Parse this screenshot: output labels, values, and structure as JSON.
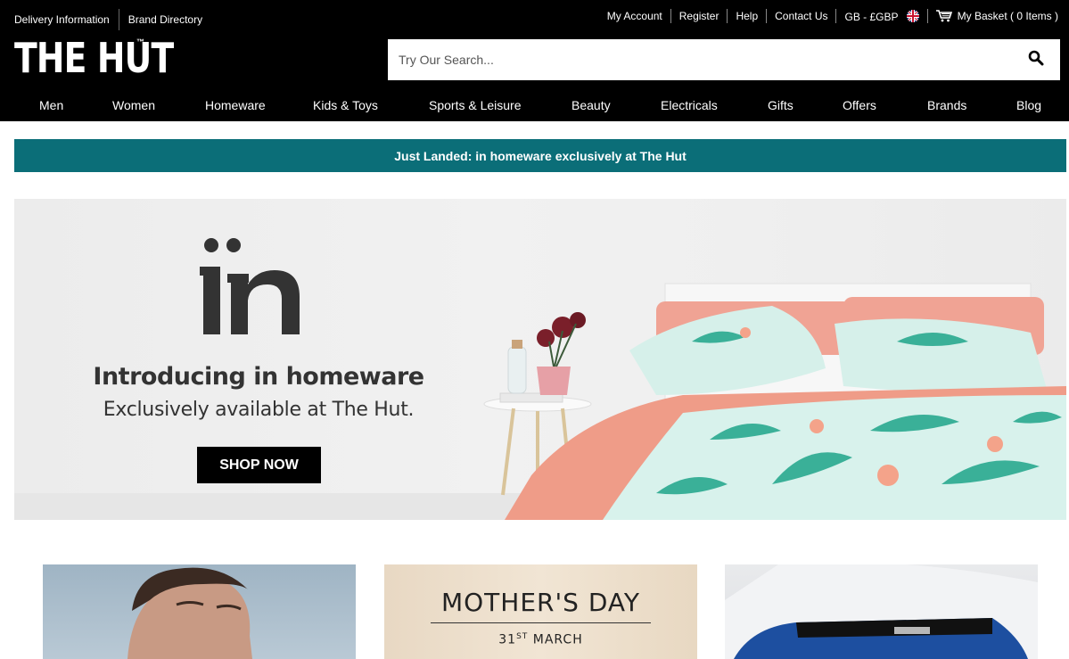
{
  "header": {
    "util_left": [
      "Delivery Information",
      "Brand Directory"
    ],
    "util_right": {
      "my_account": "My Account",
      "register": "Register",
      "help": "Help",
      "contact": "Contact Us",
      "locale": "GB - £GBP",
      "basket": "My Basket ( 0 Items )"
    },
    "logo": "THE HUT",
    "logo_tm": "™",
    "search": {
      "placeholder": "Try Our Search..."
    },
    "nav": [
      "Men",
      "Women",
      "Homeware",
      "Kids & Toys",
      "Sports & Leisure",
      "Beauty",
      "Electricals",
      "Gifts",
      "Offers",
      "Brands",
      "Blog"
    ]
  },
  "strip": {
    "text": "Just Landed: in homeware exclusively at The Hut"
  },
  "hero": {
    "logo_text": "in",
    "title": "Introducing in homeware",
    "subtitle": "Exclusively available at The Hut.",
    "cta": "SHOP NOW"
  },
  "tiles": {
    "mothers_day": {
      "title": "MOTHER'S DAY",
      "date_num": "31",
      "date_sup": "ST",
      "date_month": "MARCH"
    }
  },
  "colors": {
    "header_bg": "#000000",
    "strip_bg": "#0b6e78",
    "accent": "#ffffff"
  },
  "icons": {
    "search": "search-icon",
    "cart": "cart-icon",
    "flag": "uk-flag-icon"
  }
}
